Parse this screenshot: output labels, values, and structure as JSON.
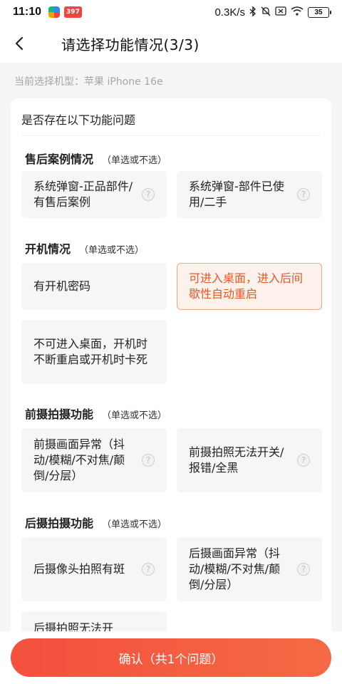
{
  "status_bar": {
    "time": "11:10",
    "app_badge": "397",
    "network_speed": "0.3K/s",
    "battery": "35",
    "icons": [
      "bluetooth-icon",
      "mute-icon",
      "sim-off-icon",
      "wifi-icon",
      "battery-icon"
    ]
  },
  "header": {
    "title": "请选择功能情况(3/3)"
  },
  "model_line": "当前选择机型：苹果 iPhone 16e",
  "card": {
    "heading": "是否存在以下功能问题",
    "sections": [
      {
        "title": "售后案例情况",
        "hint": "（单选或不选）",
        "options": [
          {
            "text": "系统弹窗-正品部件/有售后案例",
            "help": "?"
          },
          {
            "text": "系统弹窗-部件已使用/二手",
            "help": "?"
          }
        ]
      },
      {
        "title": "开机情况",
        "hint": "（单选或不选）",
        "options": [
          {
            "text": "有开机密码"
          },
          {
            "text": "可进入桌面，进入后间歇性自动重启",
            "selected": true
          },
          {
            "text": "不可进入桌面，开机时不断重启或开机时卡死"
          }
        ]
      },
      {
        "title": "前摄拍摄功能",
        "hint": "（单选或不选）",
        "options": [
          {
            "text": "前摄画面异常（抖动/模糊/不对焦/颠倒/分层）",
            "help": "?"
          },
          {
            "text": "前摄拍照无法开关/报错/全黑",
            "help": "?"
          }
        ]
      },
      {
        "title": "后摄拍摄功能",
        "hint": "（单选或不选）",
        "options": [
          {
            "text": "后摄像头拍照有斑",
            "help": "?"
          },
          {
            "text": "后摄画面异常（抖动/模糊/不对焦/颠倒/分层）",
            "help": "?"
          },
          {
            "text": "后摄拍照无法开"
          }
        ]
      }
    ]
  },
  "confirm_button": "确认（共1个问题）",
  "colors": {
    "accent": "#f4503e",
    "selected_text": "#e0592b",
    "selected_bg": "#fdf1ec"
  }
}
